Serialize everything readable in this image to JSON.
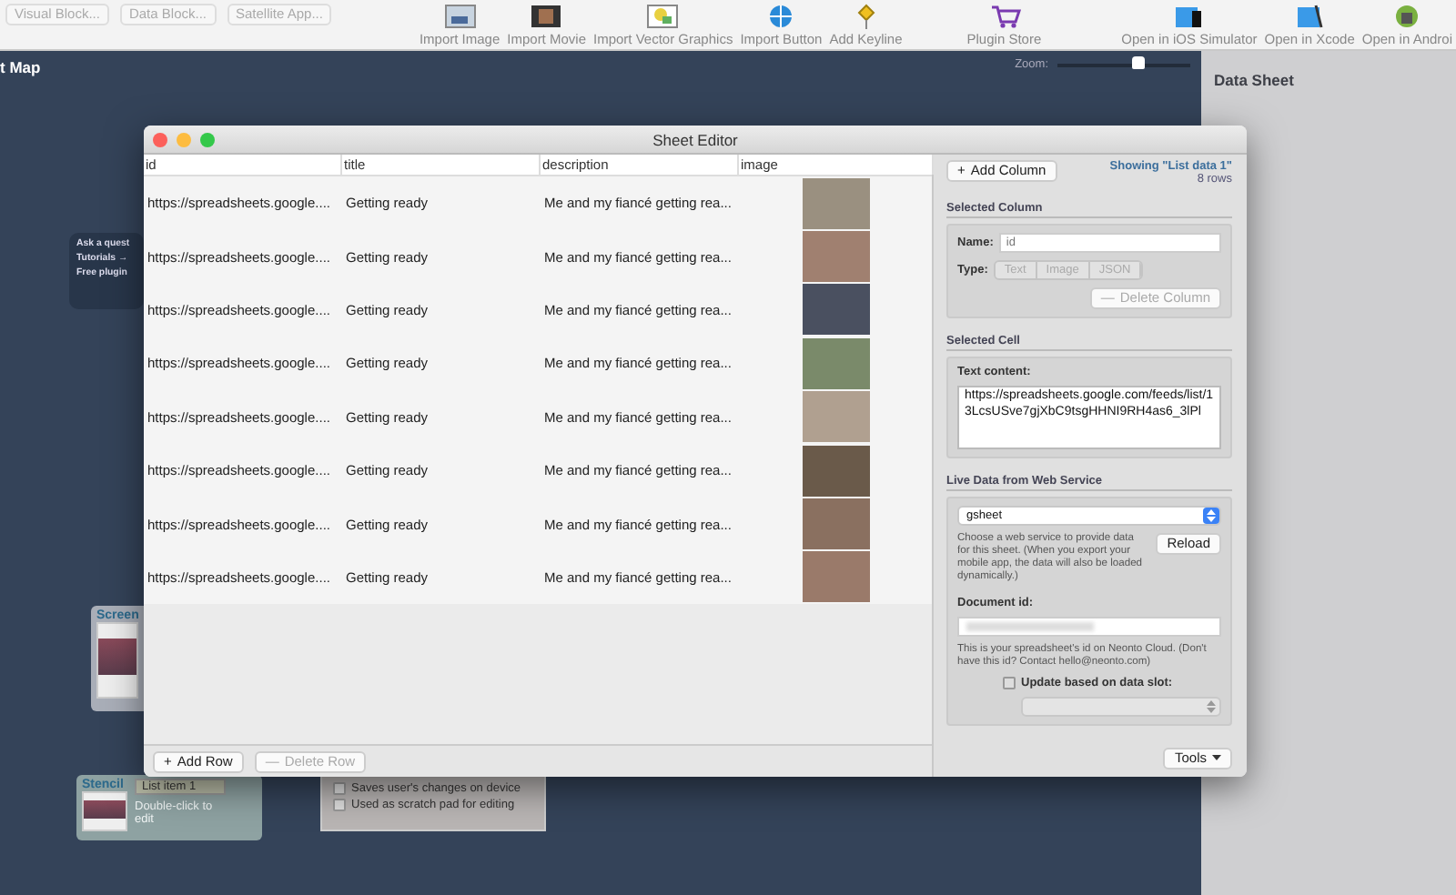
{
  "toolbar": {
    "left_buttons": [
      {
        "label": "Visual Block...",
        "disabled": true
      },
      {
        "label": "Data Block...",
        "disabled": true
      },
      {
        "label": "Satellite App...",
        "disabled": true
      }
    ],
    "tools": [
      {
        "label": "Import Image",
        "kind": "image"
      },
      {
        "label": "Import Movie",
        "kind": "movie"
      },
      {
        "label": "Import Vector Graphics",
        "kind": "vector"
      },
      {
        "label": "Import Button",
        "kind": "button"
      },
      {
        "label": "Add Keyline",
        "kind": "keyline"
      }
    ],
    "right_tools": [
      {
        "label": "Plugin Store",
        "kind": "store"
      },
      {
        "label": "Open in iOS Simulator",
        "kind": "simulator"
      },
      {
        "label": "Open in Xcode",
        "kind": "xcode"
      },
      {
        "label": "Open in Androi",
        "kind": "android"
      }
    ]
  },
  "canvas": {
    "title": "t Map",
    "zoom": {
      "label": "Zoom:",
      "level": 0.6
    },
    "help_panel": {
      "lines": [
        "Ask a quest",
        "Tutorials →",
        "Free plugin"
      ]
    },
    "screen_node": {
      "title": "Screen"
    },
    "stencil_node": {
      "title": "Stencil",
      "item": "List item 1",
      "hint": "Double-click to edit"
    },
    "sheet_options": {
      "checkboxes": [
        {
          "label": "Saves user's changes on device",
          "checked": false
        },
        {
          "label": "Used as scratch pad for editing",
          "checked": false
        }
      ]
    }
  },
  "data_sheet": {
    "title": "Data Sheet"
  },
  "sheet_editor": {
    "title": "Sheet Editor",
    "table": {
      "columns": [
        "id",
        "title",
        "description",
        "image"
      ],
      "rows": [
        {
          "id": "https://spreadsheets.google....",
          "title": "Getting ready",
          "description": "Me and my fiancé getting rea..."
        },
        {
          "id": "https://spreadsheets.google....",
          "title": "Getting ready",
          "description": "Me and my fiancé getting rea..."
        },
        {
          "id": "https://spreadsheets.google....",
          "title": "Getting ready",
          "description": "Me and my fiancé getting rea..."
        },
        {
          "id": "https://spreadsheets.google....",
          "title": "Getting ready",
          "description": "Me and my fiancé getting rea..."
        },
        {
          "id": "https://spreadsheets.google....",
          "title": "Getting ready",
          "description": "Me and my fiancé getting rea..."
        },
        {
          "id": "https://spreadsheets.google....",
          "title": "Getting ready",
          "description": "Me and my fiancé getting rea..."
        },
        {
          "id": "https://spreadsheets.google....",
          "title": "Getting ready",
          "description": "Me and my fiancé getting rea..."
        },
        {
          "id": "https://spreadsheets.google....",
          "title": "Getting ready",
          "description": "Me and my fiancé getting rea..."
        }
      ]
    },
    "bottom_buttons": [
      {
        "label": "Add Row",
        "icon": "+",
        "disabled": false
      },
      {
        "label": "Delete Row",
        "icon": "—",
        "disabled": true
      }
    ],
    "side": {
      "add_column": {
        "icon": "+",
        "label": "Add Column"
      },
      "showing": "Showing \"List data 1\"",
      "row_count": "8 rows",
      "selected_column": {
        "heading": "Selected Column",
        "name_label": "Name:",
        "name_placeholder": "id",
        "type_label": "Type:",
        "types": [
          {
            "label": "Text",
            "selected": false
          },
          {
            "label": "Image",
            "selected": false
          },
          {
            "label": "JSON",
            "selected": false
          }
        ],
        "types_disabled": true,
        "delete": {
          "icon": "—",
          "label": "Delete Column",
          "disabled": true
        }
      },
      "selected_cell": {
        "heading": "Selected Cell",
        "label": "Text content:",
        "value": "https://spreadsheets.google.com/feeds/list/13LcsUSve7gjXbC9tsgHHNI9RH4as6_3lPl"
      },
      "live_data": {
        "heading": "Live Data from Web Service",
        "service": "gsheet",
        "help": "Choose a web service to provide data for this sheet. (When you export your mobile app, the data will also be loaded dynamically.)",
        "reload": "Reload",
        "document_label": "Document id:",
        "document_note": "This is your spreadsheet's id on Neonto Cloud. (Don't have this id? Contact hello@neonto.com)",
        "update": {
          "label": "Update based on data slot:",
          "checked": false
        }
      },
      "tools": "Tools"
    }
  }
}
